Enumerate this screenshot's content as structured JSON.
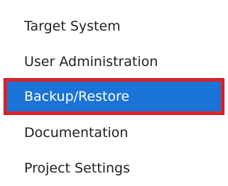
{
  "menu": {
    "items": [
      {
        "label": "Target System",
        "selected": false
      },
      {
        "label": "User Administration",
        "selected": false
      },
      {
        "label": "Backup/Restore",
        "selected": true
      },
      {
        "label": "Documentation",
        "selected": false
      },
      {
        "label": "Project Settings",
        "selected": false
      }
    ]
  },
  "colors": {
    "selected_background": "#1a73d6",
    "selected_border": "#e1202a",
    "text": "#1f1f1f",
    "selected_text": "#ffffff"
  }
}
